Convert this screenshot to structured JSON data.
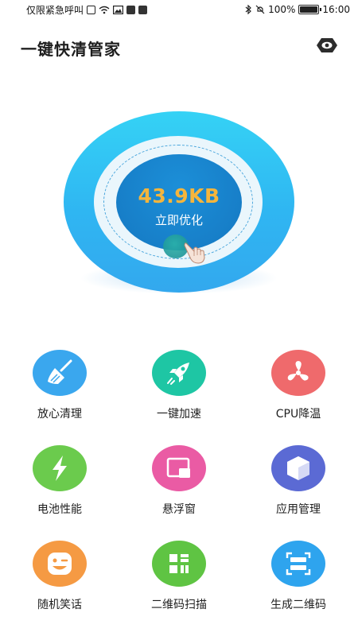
{
  "status_bar": {
    "carrier": "仅限紧急呼叫",
    "battery_text": "100%",
    "battery_level": 1.0,
    "time": "16:00"
  },
  "header": {
    "title": "一键快清管家"
  },
  "orb": {
    "size_text": "43.9KB",
    "action_label": "立即优化"
  },
  "colors": {
    "orb_outer": "#35d2f5",
    "orb_core": "#1578c2",
    "size_text": "#f5b53c"
  },
  "features": [
    {
      "label": "放心清理",
      "icon": "broom-icon",
      "color": "#3aa7ee"
    },
    {
      "label": "一键加速",
      "icon": "rocket-icon",
      "color": "#1ec6a4"
    },
    {
      "label": "CPU降温",
      "icon": "fan-icon",
      "color": "#ef6a6c"
    },
    {
      "label": "电池性能",
      "icon": "lightning-icon",
      "color": "#6bcb4d"
    },
    {
      "label": "悬浮窗",
      "icon": "floating-window-icon",
      "color": "#ea5ba4"
    },
    {
      "label": "应用管理",
      "icon": "cube-icon",
      "color": "#5b6ad4"
    },
    {
      "label": "随机笑话",
      "icon": "wink-face-icon",
      "color": "#f59a43"
    },
    {
      "label": "二维码扫描",
      "icon": "qr-scan-icon",
      "color": "#5fc443"
    },
    {
      "label": "生成二维码",
      "icon": "qr-generate-icon",
      "color": "#2ea4ee"
    }
  ]
}
